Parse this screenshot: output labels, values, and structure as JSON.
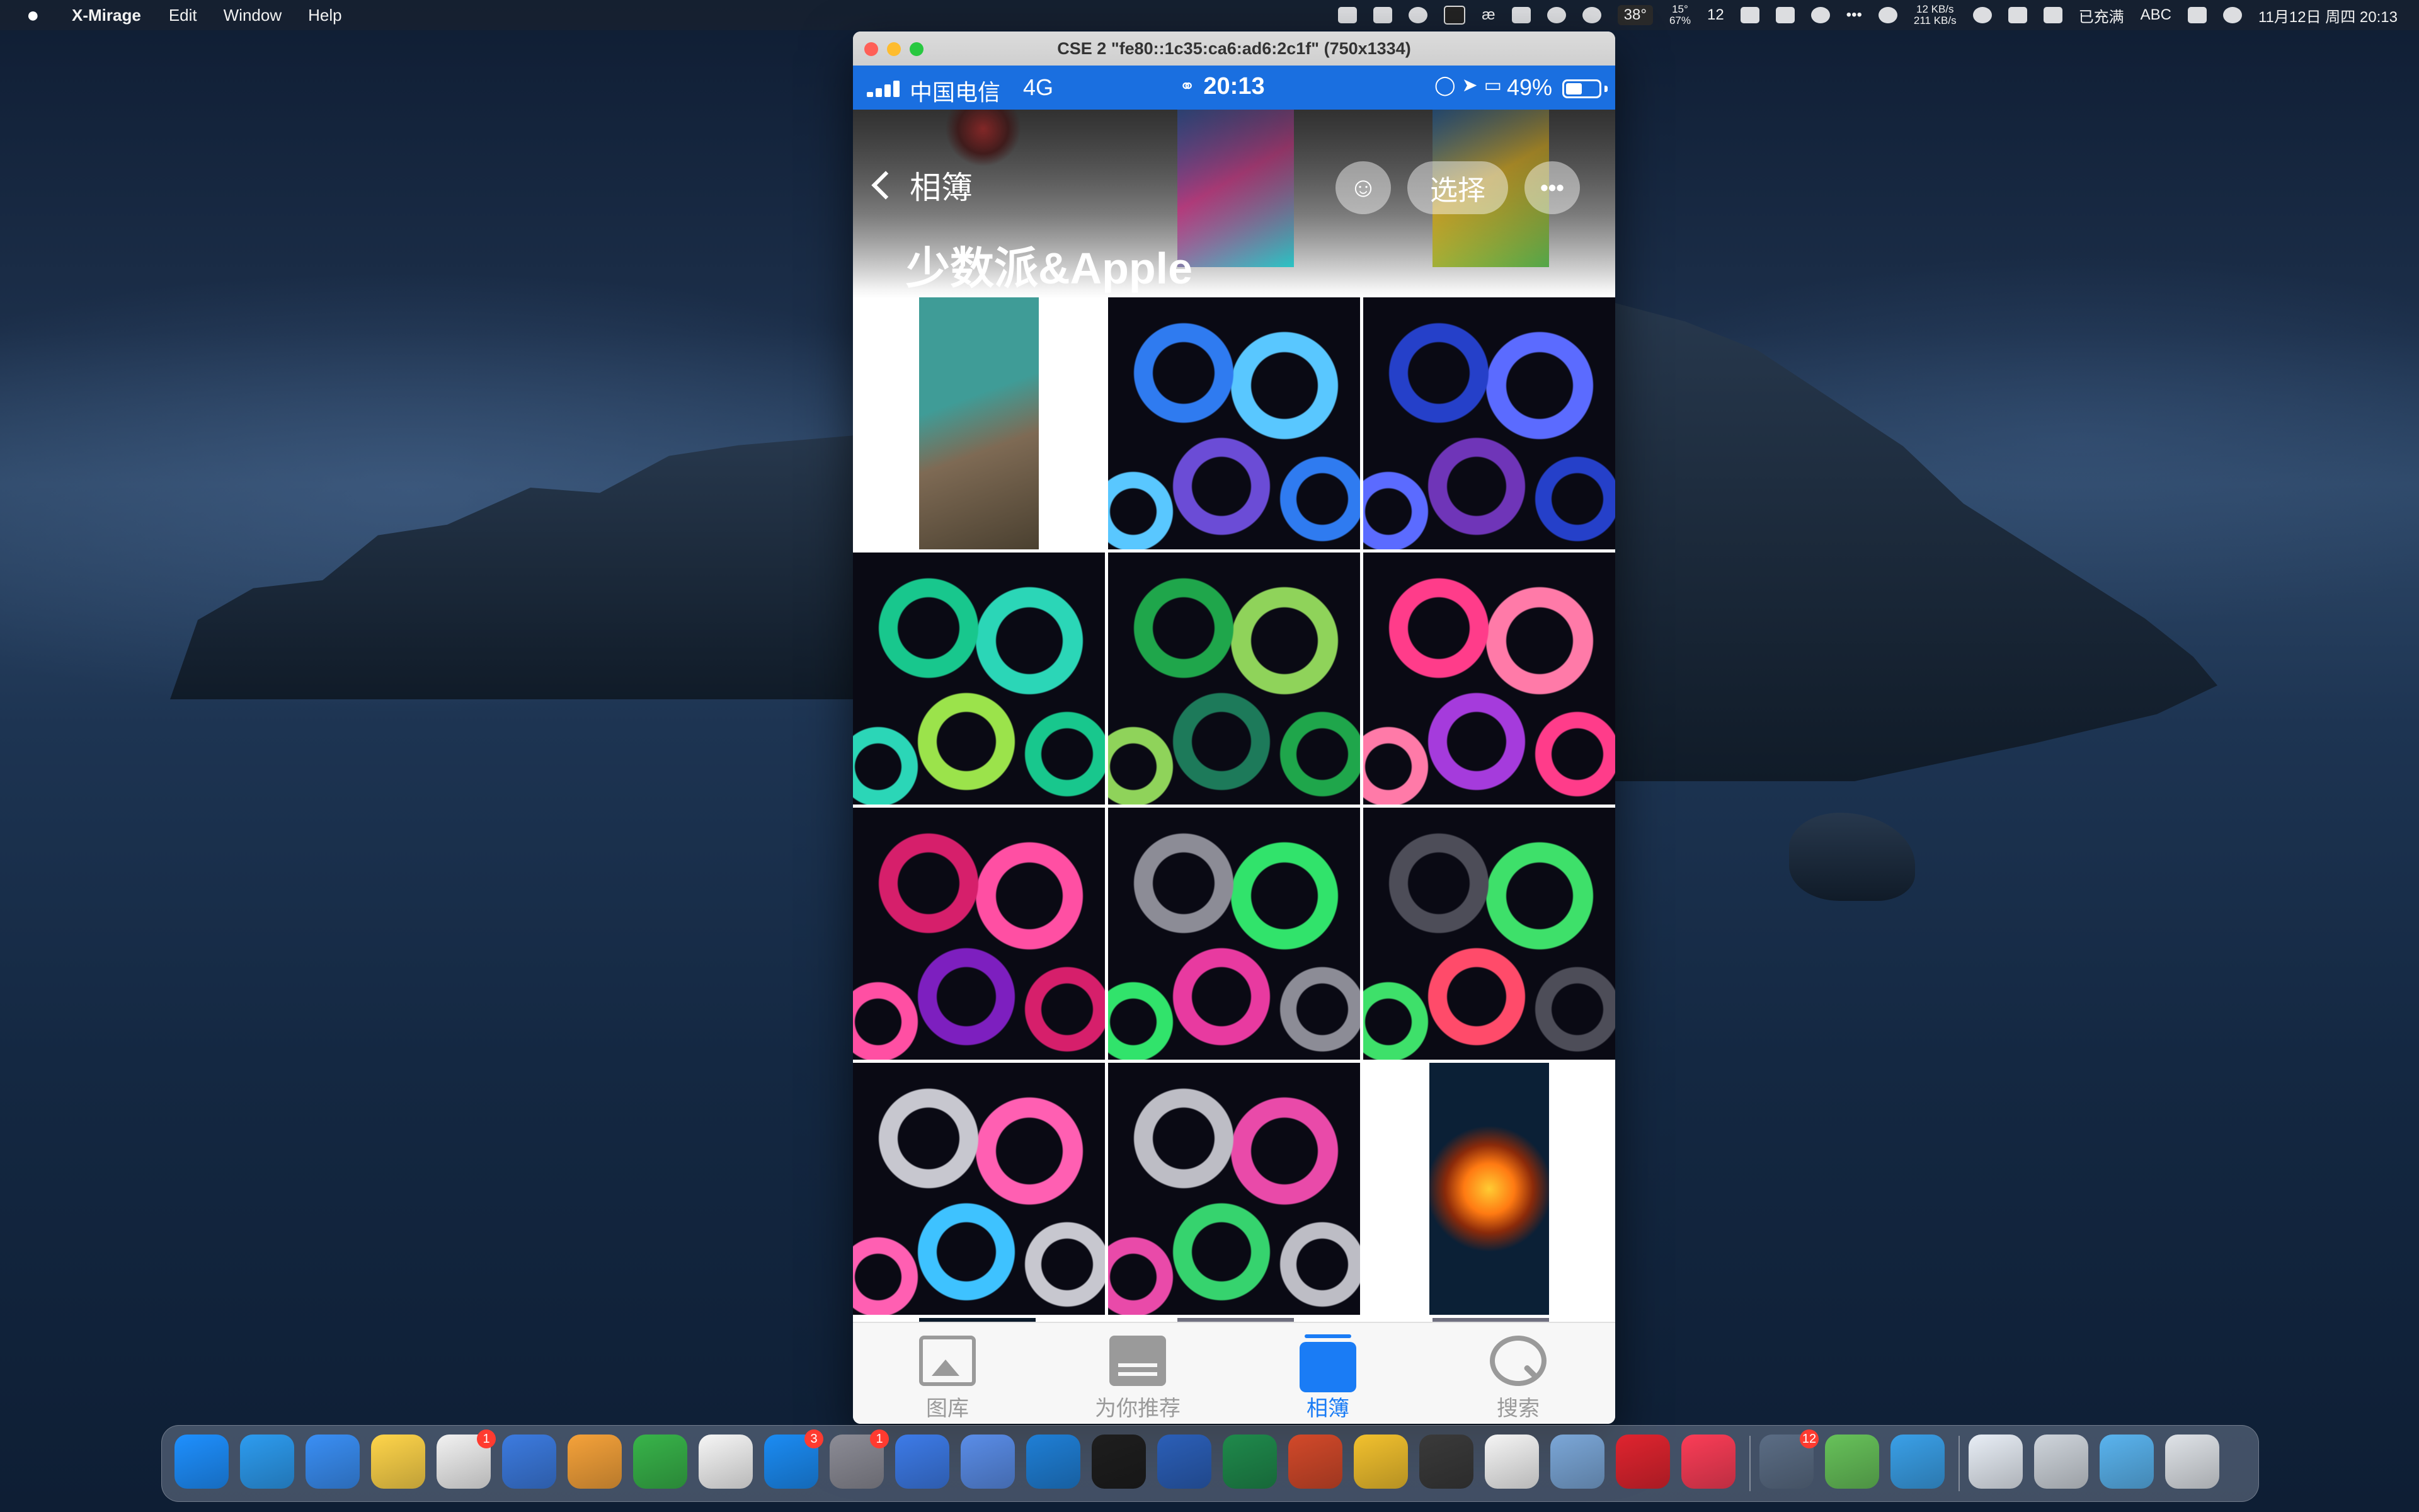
{
  "menubar": {
    "app_name": "X-Mirage",
    "menus": [
      "Edit",
      "Window",
      "Help"
    ],
    "status": {
      "temp_badge": "38°",
      "weather": "15°",
      "weather_pct": "67%",
      "update_count": "12",
      "net_up": "12 KB/s",
      "net_down": "211 KB/s",
      "battery_text": "已充满",
      "input_method": "ABC",
      "datetime": "11月12日 周四  20:13"
    }
  },
  "window": {
    "title": "CSE 2 \"fe80::1c35:ca6:ad6:2c1f\" (750x1334)"
  },
  "phone": {
    "status_bar": {
      "carrier": "中国电信",
      "network": "4G",
      "time": "20:13",
      "battery_pct": "49%",
      "battery_level": 0.49
    },
    "nav": {
      "back_label": "相簿",
      "select_label": "选择",
      "more_label": "•••"
    },
    "album_title": "少数派&Apple",
    "tabs": [
      {
        "label": "图库",
        "icon": "photos-icon"
      },
      {
        "label": "为你推荐",
        "icon": "for-you-icon"
      },
      {
        "label": "相簿",
        "icon": "albums-icon",
        "active": true
      },
      {
        "label": "搜索",
        "icon": "search-icon"
      }
    ]
  },
  "photo_grid": {
    "photos": [
      {
        "kind": "coast-photo",
        "colors": [
          "#3f9c97",
          "#7e6a54"
        ]
      },
      {
        "kind": "loops",
        "colors": [
          "#2f7bf0",
          "#59c7ff",
          "#6b4cd6"
        ]
      },
      {
        "kind": "loops",
        "colors": [
          "#2540c9",
          "#5b6bff",
          "#6f35b8"
        ]
      },
      {
        "kind": "loops",
        "colors": [
          "#18c78d",
          "#2bd6b7",
          "#9be34b"
        ]
      },
      {
        "kind": "loops",
        "colors": [
          "#1fa64b",
          "#8fd35a",
          "#1d7a5a"
        ]
      },
      {
        "kind": "loops",
        "colors": [
          "#ff3c8a",
          "#ff7aa8",
          "#a53bdc"
        ]
      },
      {
        "kind": "loops",
        "colors": [
          "#d61f6b",
          "#ff4fa3",
          "#7d1fbf"
        ]
      },
      {
        "kind": "loops",
        "colors": [
          "#8c8c96",
          "#31e36b",
          "#e83aa0"
        ]
      },
      {
        "kind": "loops",
        "colors": [
          "#4d4d58",
          "#3ee06a",
          "#ff4b6a"
        ]
      },
      {
        "kind": "loops",
        "colors": [
          "#c7c7cf",
          "#ff5fb2",
          "#3ec2ff"
        ]
      },
      {
        "kind": "loops",
        "colors": [
          "#bdbdc5",
          "#e94aa9",
          "#36d36e"
        ]
      },
      {
        "kind": "orb-wallpaper",
        "colors": [
          "#0b2036",
          "#ff7a12",
          "#ffcc33"
        ]
      }
    ],
    "header_strips": [
      {
        "kind": "apple-logo-wallpaper",
        "colors": [
          "#5a1a1a",
          "#e23030"
        ]
      },
      {
        "kind": "paint-splash",
        "colors": [
          "#3b6bd6",
          "#e2459a",
          "#2ad0d0"
        ]
      },
      {
        "kind": "paint-splash",
        "colors": [
          "#2a77c8",
          "#f3c32a",
          "#56b04c"
        ]
      }
    ]
  },
  "dock": {
    "apps": [
      {
        "icon": "finder-icon",
        "color": "#1e90ff"
      },
      {
        "icon": "safari-icon",
        "color": "#2d9cf0"
      },
      {
        "icon": "mail-icon",
        "color": "#3a8ff5"
      },
      {
        "icon": "notes-icon",
        "color": "#ffd54a"
      },
      {
        "icon": "reminders-icon",
        "color": "#f2f2f2",
        "badge": "1"
      },
      {
        "icon": "keynote-icon",
        "color": "#3c7be0"
      },
      {
        "icon": "pages-icon",
        "color": "#f5a23a"
      },
      {
        "icon": "numbers-icon",
        "color": "#38b44a"
      },
      {
        "icon": "photos-app-icon",
        "color": "#f6f6f6"
      },
      {
        "icon": "app-store-icon",
        "color": "#1b8cf4",
        "badge": "3"
      },
      {
        "icon": "system-preferences-icon",
        "color": "#8c8c96",
        "badge": "1"
      },
      {
        "icon": "xcode-icon",
        "color": "#3d7be8"
      },
      {
        "icon": "xcode-beta-icon",
        "color": "#5a8de8"
      },
      {
        "icon": "vscode-icon",
        "color": "#1f7fd6"
      },
      {
        "icon": "terminal-icon",
        "color": "#1e1e1e"
      },
      {
        "icon": "word-icon",
        "color": "#2b5fb8"
      },
      {
        "icon": "excel-icon",
        "color": "#1f8a4c"
      },
      {
        "icon": "powerpoint-icon",
        "color": "#d2492a"
      },
      {
        "icon": "butterfly-app-icon",
        "color": "#f2c12e"
      },
      {
        "icon": "console-icon",
        "color": "#3a3a3a"
      },
      {
        "icon": "qq-icon",
        "color": "#f5f5f5"
      },
      {
        "icon": "preview-icon",
        "color": "#7ba7d8"
      },
      {
        "icon": "opera-icon",
        "color": "#e0242f"
      },
      {
        "icon": "music-icon",
        "color": "#fb3d57"
      },
      {
        "icon": "instruments-icon",
        "color": "#5b6d85",
        "badge": "12"
      },
      {
        "icon": "adguard-icon",
        "color": "#67c25a"
      },
      {
        "icon": "x-mirage-icon",
        "color": "#3aa0e8"
      },
      {
        "icon": "txt-document-icon",
        "color": "#e8eef6"
      },
      {
        "icon": "printer-icon",
        "color": "#cfd5dc"
      },
      {
        "icon": "downloads-folder-icon",
        "color": "#5ab4ef"
      },
      {
        "icon": "trash-icon",
        "color": "#dfe3e8"
      }
    ]
  }
}
